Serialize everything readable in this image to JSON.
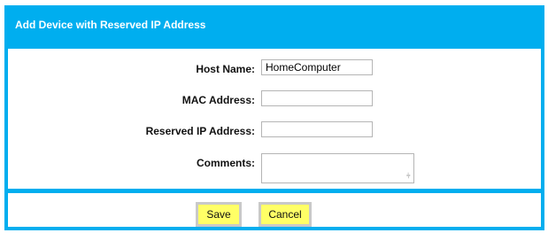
{
  "dialog": {
    "title": "Add Device with Reserved IP Address"
  },
  "form": {
    "host_name_label": "Host Name:",
    "host_name_value": "HomeComputer",
    "mac_label": "MAC Address:",
    "mac_value": "",
    "ip_label": "Reserved IP Address:",
    "ip_value": "",
    "comments_label": "Comments:",
    "comments_value": ""
  },
  "actions": {
    "save_label": "Save",
    "cancel_label": "Cancel"
  },
  "colors": {
    "accent": "#00aeef",
    "button": "#ffff66"
  }
}
